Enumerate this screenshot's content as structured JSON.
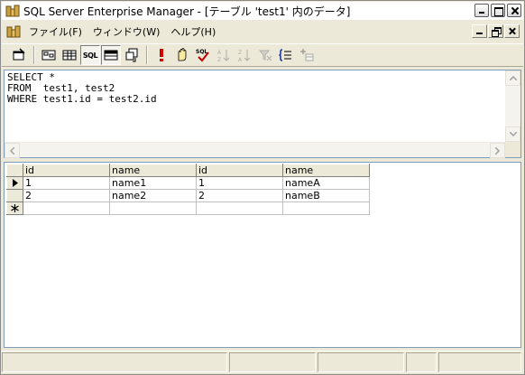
{
  "window": {
    "title": "SQL Server Enterprise Manager - [テーブル 'test1' 内のデータ]"
  },
  "menu": {
    "items": [
      {
        "label": "ファイル(F)"
      },
      {
        "label": "ウィンドウ(W)"
      },
      {
        "label": "ヘルプ(H)"
      }
    ]
  },
  "toolbar": {
    "sql_label": "SQL",
    "sql_check_label": "SQL"
  },
  "sql": {
    "text": "SELECT *\nFROM  test1, test2\nWHERE test1.id = test2.id"
  },
  "grid": {
    "columns": [
      "id",
      "name",
      "id",
      "name"
    ],
    "rows": [
      {
        "marker": "current-row",
        "cells": [
          "1",
          "name1",
          "1",
          "nameA"
        ]
      },
      {
        "marker": "",
        "cells": [
          "2",
          "name2",
          "2",
          "nameB"
        ]
      },
      {
        "marker": "new-row",
        "cells": [
          "",
          "",
          "",
          ""
        ]
      }
    ]
  }
}
